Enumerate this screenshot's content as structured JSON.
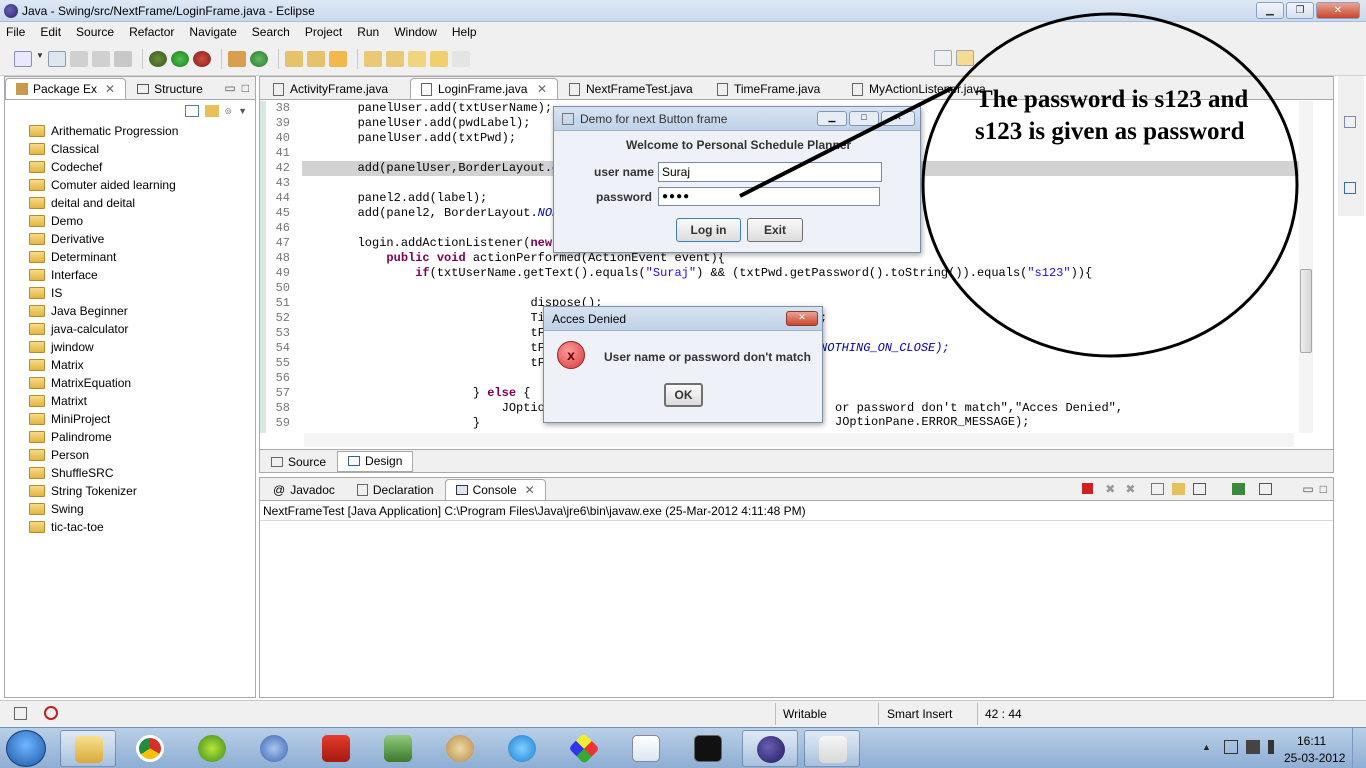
{
  "window": {
    "title": "Java - Swing/src/NextFrame/LoginFrame.java - Eclipse"
  },
  "menu": [
    "File",
    "Edit",
    "Source",
    "Refactor",
    "Navigate",
    "Search",
    "Project",
    "Run",
    "Window",
    "Help"
  ],
  "package_explorer": {
    "tabs": [
      "Package Ex",
      "Structure"
    ],
    "items": [
      "Arithematic Progression",
      "Classical",
      "Codechef",
      "Comuter aided learning",
      "deital and deital",
      "Demo",
      "Derivative",
      "Determinant",
      "Interface",
      "IS",
      "Java Beginner",
      "java-calculator",
      "jwindow",
      "Matrix",
      "MatrixEquation",
      "Matrixt",
      "MiniProject",
      "Palindrome",
      "Person",
      "ShuffleSRC",
      "String Tokenizer",
      "Swing",
      "tic-tac-toe"
    ]
  },
  "editor": {
    "tabs": [
      "ActivityFrame.java",
      "LoginFrame.java",
      "NextFrameTest.java",
      "TimeFrame.java",
      "MyActionListener.java"
    ],
    "lines": [
      {
        "n": "38",
        "t": "        panelUser.add(txtUserName);"
      },
      {
        "n": "39",
        "t": "        panelUser.add(pwdLabel);"
      },
      {
        "n": "40",
        "t": "        panelUser.add(txtPwd);"
      },
      {
        "n": "41",
        "t": ""
      },
      {
        "n": "42",
        "t": "        add(panelUser,BorderLayout.C"
      },
      {
        "n": "43",
        "t": ""
      },
      {
        "n": "44",
        "t": "        panel2.add(label);"
      },
      {
        "n": "45",
        "t": "        add(panel2, BorderLayout.NOR"
      },
      {
        "n": "46",
        "t": ""
      },
      {
        "n": "47",
        "t": "        login.addActionListener(new "
      },
      {
        "n": "48",
        "t": "            public void actionPerformed(ActionEvent event){"
      },
      {
        "n": "49",
        "t": "                if(txtUserName.getText().equals(\"Suraj\") && (txtPwd.getPassword().toString()).equals(\"s123\")){"
      },
      {
        "n": "50",
        "t": ""
      },
      {
        "n": "51",
        "t": "                                dispose();"
      },
      {
        "n": "52",
        "t": "                                Tin"
      },
      {
        "n": "53",
        "t": "                                tFr"
      },
      {
        "n": "54",
        "t": "                                tFr"
      },
      {
        "n": "55",
        "t": "                                tFr"
      },
      {
        "n": "56",
        "t": ""
      },
      {
        "n": "57",
        "t": "                        } else {"
      },
      {
        "n": "58",
        "t": "                            JOptio"
      },
      {
        "n": "59",
        "t": "                        }"
      }
    ],
    "line52_tail": ";",
    "line54_tail": "NOTHING_ON_CLOSE);",
    "line58_tail": "or password don't match\",\"Acces Denied\", JOptionPane.ERROR_MESSAGE);",
    "bottom_tabs": [
      "Source",
      "Design"
    ]
  },
  "login_dialog": {
    "title": "Demo for next Button frame",
    "welcome": "Welcome to Personal Schedule Planner",
    "user_label": "user name",
    "user_value": "Suraj",
    "pwd_label": "password",
    "pwd_value": "●●●●",
    "login_btn": "Log in",
    "exit_btn": "Exit"
  },
  "error_dialog": {
    "title": "Acces Denied",
    "message": "User name or password don't match",
    "ok": "OK"
  },
  "annotation": {
    "line1": "The password is s123 and",
    "line2": "s123 is given as password"
  },
  "console": {
    "tabs": [
      "Javadoc",
      "Declaration",
      "Console"
    ],
    "header": "NextFrameTest [Java Application] C:\\Program Files\\Java\\jre6\\bin\\javaw.exe (25-Mar-2012 4:11:48 PM)"
  },
  "status": {
    "mode": "Writable",
    "insert": "Smart Insert",
    "pos": "42 : 44"
  },
  "taskbar": {
    "time": "16:11",
    "date": "25-03-2012"
  },
  "colors": {
    "keyword": "#7f0055",
    "string": "#2a00ff",
    "constant": "#0000c0",
    "error_red": "#cc2222"
  }
}
